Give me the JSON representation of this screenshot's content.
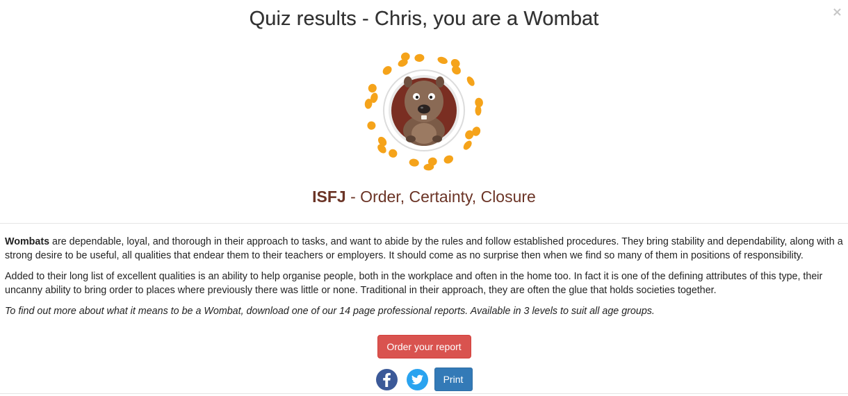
{
  "dialog": {
    "title": "Quiz results - Chris, you are a Wombat",
    "close_label": "×"
  },
  "result": {
    "image_alt": "Wombat character",
    "type_code": "ISFJ",
    "type_tagline": " - Order, Certainty, Closure"
  },
  "description": {
    "p1_lead": "Wombats",
    "p1_rest": " are dependable, loyal, and thorough in their approach to tasks, and want to abide by the rules and follow established procedures. They bring stability and dependability, along with a strong desire to be useful, all qualities that endear them to their teachers or employers. It should come as no surprise then when we find so many of them in positions of responsibility.",
    "p2": "Added to their long list of excellent qualities is an ability to help organise people, both in the workplace and often in the home too. In fact it is one of the defining attributes of this type, their uncanny ability to bring order to places where previously there was little or none. Traditional in their approach, they are often the glue that holds societies together.",
    "p3": "To find out more about what it means to be a Wombat, download one of our 14 page professional reports. Available in 3 levels to suit all age groups."
  },
  "actions": {
    "order_label": "Order your report",
    "print_label": "Print",
    "facebook_icon": "facebook-icon",
    "twitter_icon": "twitter-icon"
  },
  "colors": {
    "accent_brown": "#6b3426",
    "order_red": "#d9534f",
    "print_blue": "#337ab7",
    "facebook_blue": "#3b5998",
    "twitter_blue": "#2aa3ef",
    "dot_orange": "#f5a31a"
  }
}
